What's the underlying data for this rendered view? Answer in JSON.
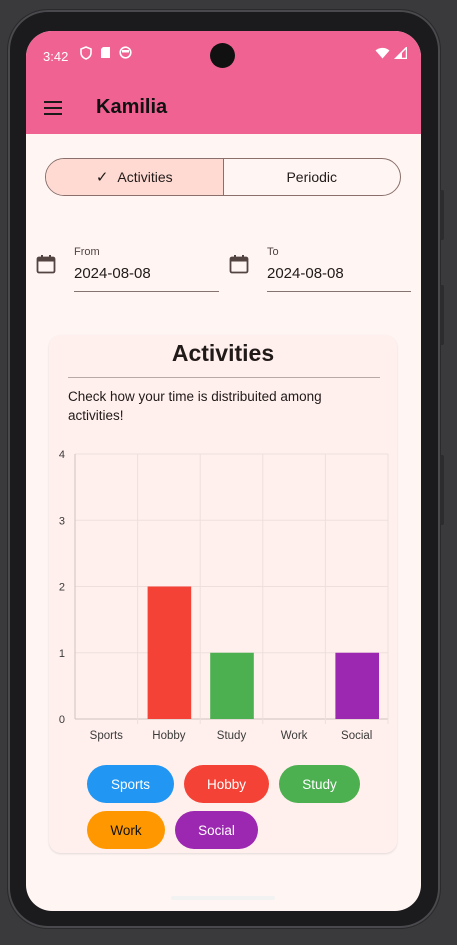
{
  "status_bar": {
    "time": "3:42"
  },
  "app_bar": {
    "title": "Kamilia"
  },
  "segments": [
    {
      "label": "Activities",
      "selected": true
    },
    {
      "label": "Periodic",
      "selected": false
    }
  ],
  "date_range": {
    "from": {
      "label": "From",
      "value": "2024-08-08"
    },
    "to": {
      "label": "To",
      "value": "2024-08-08"
    }
  },
  "card": {
    "title": "Activities",
    "description": "Check how your time is distribuited among activities!"
  },
  "chart_data": {
    "type": "bar",
    "categories": [
      "Sports",
      "Hobby",
      "Study",
      "Work",
      "Social"
    ],
    "values": [
      0,
      2,
      1,
      0,
      1
    ],
    "colors": [
      "#2196f3",
      "#f44336",
      "#4caf50",
      "#ff9800",
      "#9c27b0"
    ],
    "ylim": [
      0,
      4
    ],
    "yticks": [
      0,
      1,
      2,
      3,
      4
    ],
    "grid": true
  },
  "legend_chips": [
    {
      "label": "Sports",
      "color": "#2196f3"
    },
    {
      "label": "Hobby",
      "color": "#f44336"
    },
    {
      "label": "Study",
      "color": "#4caf50"
    },
    {
      "label": "Work",
      "color": "#ff9800"
    },
    {
      "label": "Social",
      "color": "#9c27b0"
    }
  ],
  "colors": {
    "accent": "#f06292",
    "selected_segment": "#ffdad2",
    "card_bg": "#fff0ed",
    "screen_bg": "#fff6f4"
  }
}
